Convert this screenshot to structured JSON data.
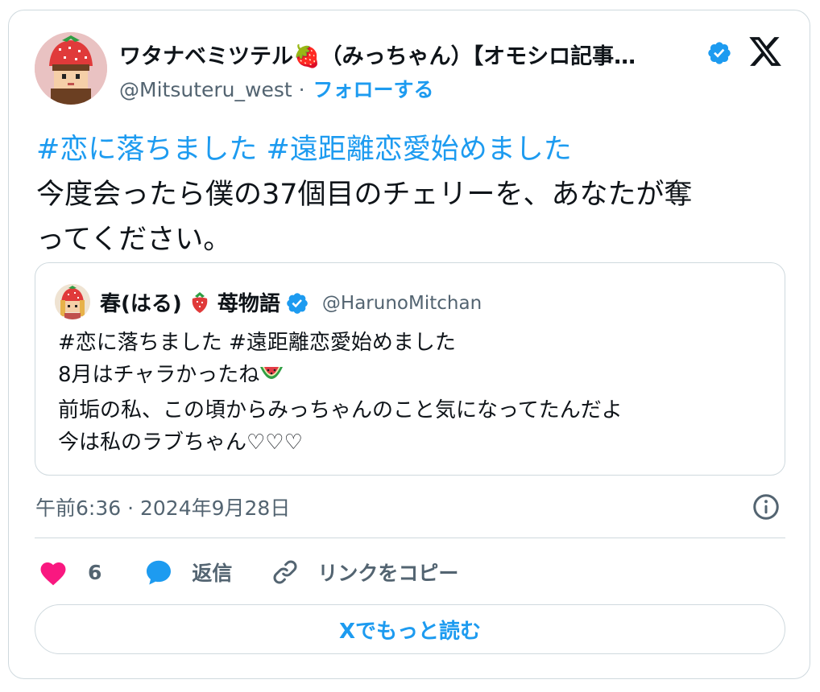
{
  "author": {
    "name": "ワタナベミツテル🍓（みっちゃん）【オモシロ記事…",
    "handle": "@Mitsuteru_west",
    "separator": "·",
    "follow_label": "フォローする",
    "verified": true,
    "avatar_icon": "strawberry-hat-boy-avatar"
  },
  "brand_icon": "x-logo-icon",
  "tweet": {
    "hashtag_line": "#恋に落ちました #遠距離恋愛始めました",
    "lines": [
      "今度会ったら僕の37個目のチェリーを、あなたが奪",
      "ってください。"
    ]
  },
  "quote": {
    "name": "春(はる)",
    "name_emoji": "🍓",
    "name_suffix": "苺物語",
    "handle": "@HarunoMitchan",
    "verified": true,
    "avatar_icon": "strawberry-girl-avatar",
    "lines": [
      "#恋に落ちました #遠距離恋愛始めました",
      "8月はチャラかったね",
      "前垢の私、この頃からみっちゃんのこと気になってたんだよ",
      "今は私のラブちゃん♡♡♡"
    ],
    "line2_emoji": "watermelon-icon"
  },
  "timestamp": "午前6:36 · 2024年9月28日",
  "actions": {
    "like_count": "6",
    "reply_label": "返信",
    "copy_link_label": "リンクをコピー"
  },
  "read_more_label": "Xでもっと読む",
  "colors": {
    "accent": "#1d9bf0",
    "heart": "#f91880",
    "text": "#0f1419",
    "muted": "#536471",
    "border": "#cfd9de"
  }
}
